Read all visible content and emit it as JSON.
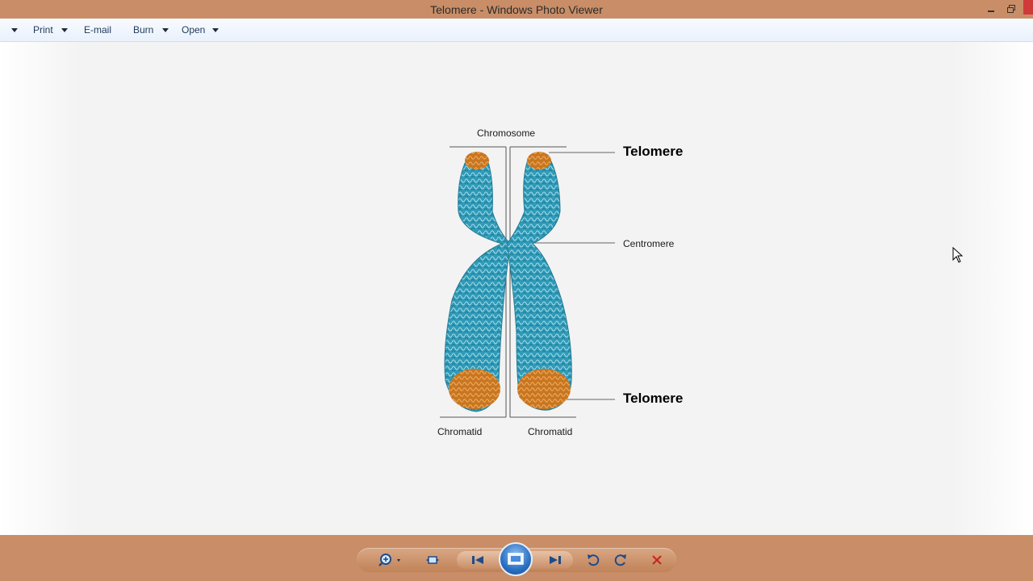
{
  "window": {
    "title": "Telomere - Windows Photo Viewer"
  },
  "menu": {
    "items": [
      {
        "label": "Print"
      },
      {
        "label": "E-mail"
      },
      {
        "label": "Burn"
      },
      {
        "label": "Open"
      }
    ]
  },
  "image": {
    "labels": {
      "chromosome": "Chromosome",
      "telomere_top": "Telomere",
      "centromere": "Centromere",
      "telomere_bottom": "Telomere",
      "chromatid_left": "Chromatid",
      "chromatid_right": "Chromatid"
    },
    "colors": {
      "chromatid": "#2f9bb8",
      "telomere": "#c9761f"
    }
  },
  "toolbar": {
    "icons": [
      "zoom-icon",
      "actual-size-icon",
      "previous-icon",
      "slideshow-icon",
      "next-icon",
      "rotate-left-icon",
      "rotate-right-icon",
      "delete-icon"
    ]
  }
}
